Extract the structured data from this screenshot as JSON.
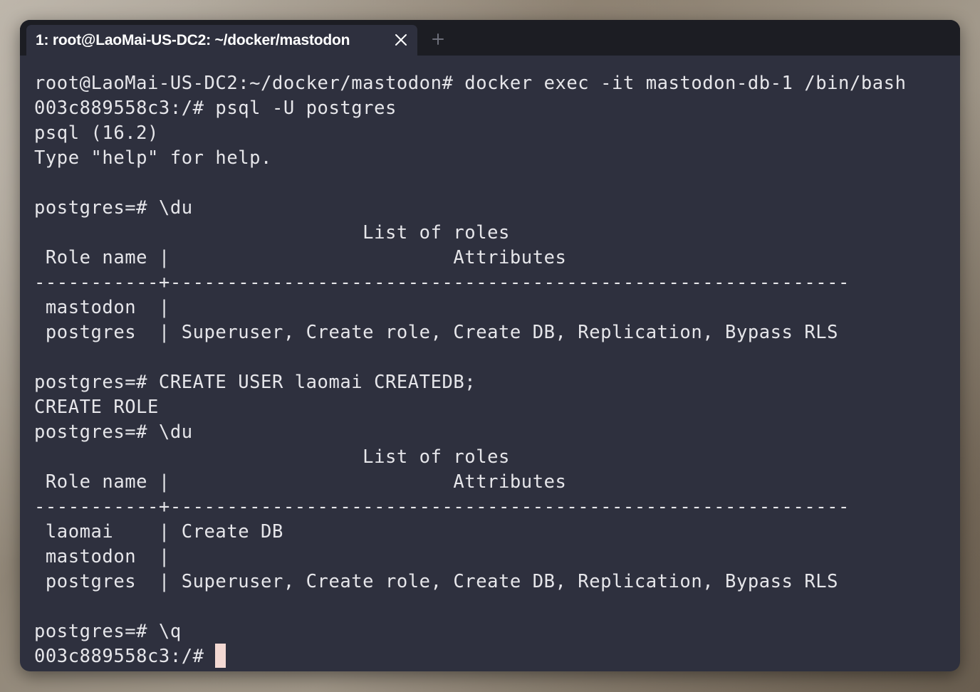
{
  "window": {
    "tab": {
      "title": "1: root@LaoMai-US-DC2: ~/docker/mastodon",
      "close_icon": "close-icon"
    },
    "new_tab_icon": "plus-icon"
  },
  "terminal": {
    "lines": [
      "root@LaoMai-US-DC2:~/docker/mastodon# docker exec -it mastodon-db-1 /bin/bash",
      "003c889558c3:/# psql -U postgres",
      "psql (16.2)",
      "Type \"help\" for help.",
      "",
      "postgres=# \\du",
      "                             List of roles",
      " Role name |                         Attributes",
      "-----------+------------------------------------------------------------",
      " mastodon  |",
      " postgres  | Superuser, Create role, Create DB, Replication, Bypass RLS",
      "",
      "postgres=# CREATE USER laomai CREATEDB;",
      "CREATE ROLE",
      "postgres=# \\du",
      "                             List of roles",
      " Role name |                         Attributes",
      "-----------+------------------------------------------------------------",
      " laomai    | Create DB",
      " mastodon  |",
      " postgres  | Superuser, Create role, Create DB, Replication, Bypass RLS",
      "",
      "postgres=# \\q"
    ],
    "prompt": "003c889558c3:/# "
  },
  "colors": {
    "terminal_bg": "#2e303e",
    "tabbar_bg": "#1c1d23",
    "text": "#e6e6ea",
    "cursor": "#f3d9d3"
  }
}
